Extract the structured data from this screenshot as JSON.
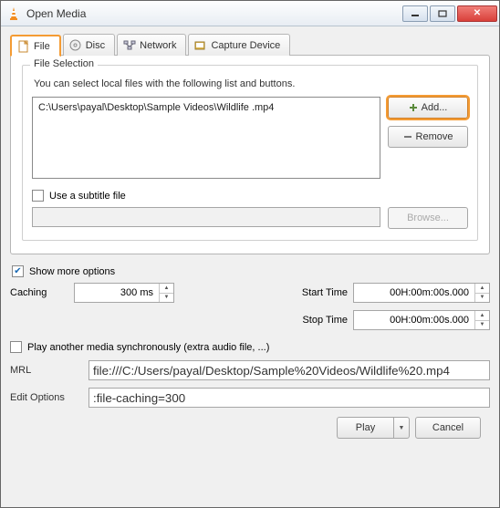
{
  "window": {
    "title": "Open Media"
  },
  "tabs": {
    "file": "File",
    "disc": "Disc",
    "network": "Network",
    "capture": "Capture Device"
  },
  "fileSelection": {
    "legend": "File Selection",
    "help": "You can select local files with the following list and buttons.",
    "files": [
      "C:\\Users\\payal\\Desktop\\Sample Videos\\Wildlife .mp4"
    ],
    "addLabel": "Add...",
    "removeLabel": "Remove"
  },
  "subtitle": {
    "checkboxLabel": "Use a subtitle file",
    "path": "",
    "browseLabel": "Browse..."
  },
  "moreOptions": {
    "checkboxLabel": "Show more options",
    "checked": true
  },
  "caching": {
    "label": "Caching",
    "value": "300 ms"
  },
  "startTime": {
    "label": "Start Time",
    "value": "00H:00m:00s.000"
  },
  "stopTime": {
    "label": "Stop Time",
    "value": "00H:00m:00s.000"
  },
  "extraAudio": {
    "label": "Play another media synchronously (extra audio file, ...)",
    "checked": false
  },
  "mrl": {
    "label": "MRL",
    "value": "file:///C:/Users/payal/Desktop/Sample%20Videos/Wildlife%20.mp4"
  },
  "editOptions": {
    "label": "Edit Options",
    "value": ":file-caching=300"
  },
  "footer": {
    "play": "Play",
    "cancel": "Cancel"
  }
}
